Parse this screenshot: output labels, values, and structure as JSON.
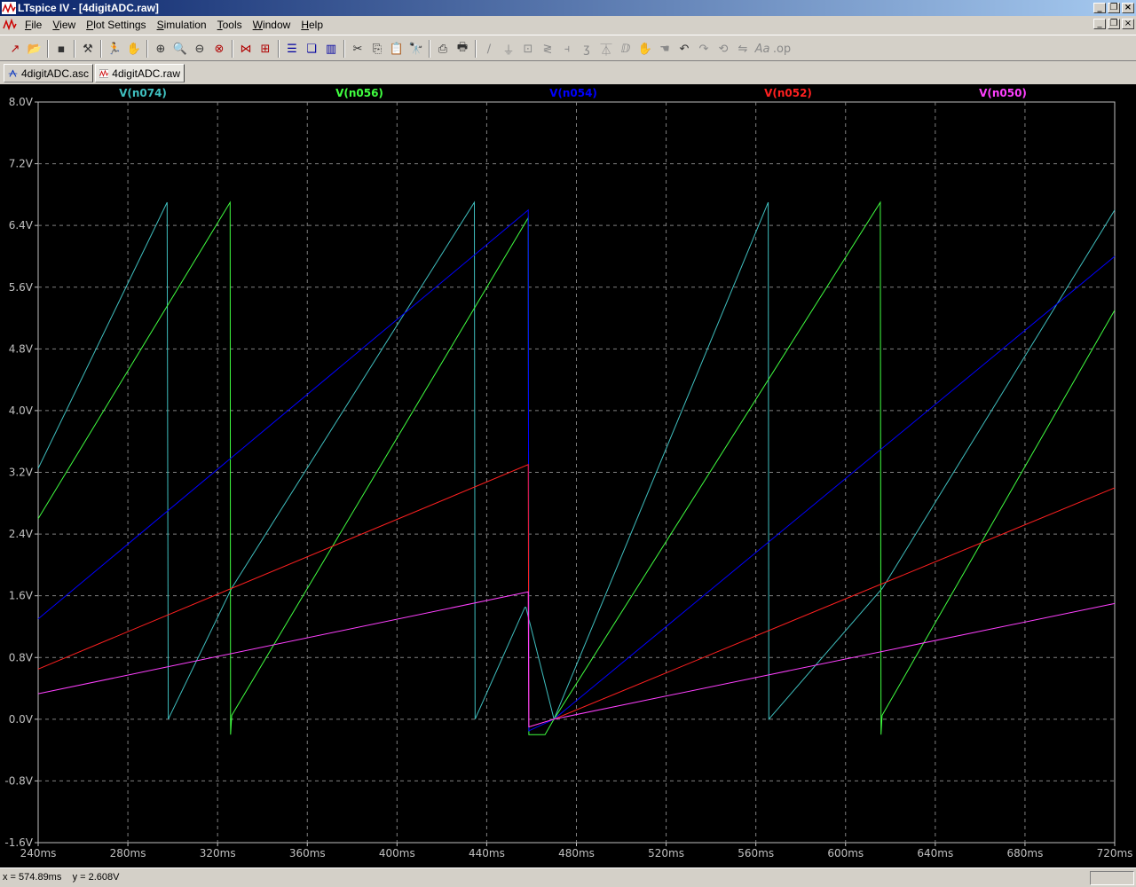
{
  "window": {
    "title": "LTspice IV - [4digitADC.raw]"
  },
  "menu": {
    "items": [
      "File",
      "View",
      "Plot Settings",
      "Simulation",
      "Tools",
      "Window",
      "Help"
    ]
  },
  "toolbar": {
    "icons": [
      "new-schematic-icon",
      "open-icon",
      "save-icon",
      "control-panel-icon",
      "run-icon",
      "halt-icon",
      "zoom-in-icon",
      "zoom-area-icon",
      "zoom-out-icon",
      "zoom-cancel-icon",
      "autorange-icon",
      "grid-icon",
      "tile-horizontal-icon",
      "cascade-icon",
      "tile-vertical-icon",
      "cut-icon",
      "copy-icon",
      "paste-icon",
      "find-icon",
      "print-preview-icon",
      "print-icon",
      "wire-icon",
      "ground-icon",
      "label-net-icon",
      "resistor-icon",
      "capacitor-icon",
      "inductor-icon",
      "diode-icon",
      "component-icon",
      "move-icon",
      "drag-icon",
      "undo-icon",
      "redo-icon",
      "rotate-icon",
      "mirror-icon",
      "text-icon",
      "spice-directive-icon"
    ]
  },
  "tabs": [
    {
      "label": "4digitADC.asc",
      "icon": "schematic-icon"
    },
    {
      "label": "4digitADC.raw",
      "icon": "waveform-icon"
    }
  ],
  "status": {
    "x_readout": "x = 574.89ms",
    "y_readout": "y = 2.608V"
  },
  "chart_data": {
    "type": "line",
    "xlabel": "",
    "ylabel": "",
    "xlim": [
      240,
      720
    ],
    "ylim": [
      -1.6,
      8.0
    ],
    "x_ticks": [
      "240ms",
      "280ms",
      "320ms",
      "360ms",
      "400ms",
      "440ms",
      "480ms",
      "520ms",
      "560ms",
      "600ms",
      "640ms",
      "680ms",
      "720ms"
    ],
    "y_ticks": [
      "8.0V",
      "7.2V",
      "6.4V",
      "5.6V",
      "4.8V",
      "4.0V",
      "3.2V",
      "2.4V",
      "1.6V",
      "0.8V",
      "0.0V",
      "-0.8V",
      "-1.6V"
    ],
    "grid": true,
    "series": [
      {
        "name": "V(n074)",
        "color": "#3fbfbf",
        "x": [
          240,
          297.5,
          298,
          326.3,
          326.3,
          434.5,
          434.8,
          457,
          457.5,
          470,
          565.5,
          565.8,
          616.5,
          616.5,
          720
        ],
        "y": [
          3.25,
          6.7,
          0.0,
          1.7,
          1.7,
          6.7,
          0.0,
          1.45,
          1.45,
          0.0,
          6.7,
          0.0,
          1.7,
          1.7,
          6.6
        ]
      },
      {
        "name": "V(n056)",
        "color": "#40ff40",
        "x": [
          240,
          325.6,
          325.8,
          326.3,
          458.5,
          458.8,
          464,
          466,
          470,
          615.5,
          615.8,
          616.3,
          720
        ],
        "y": [
          2.6,
          6.7,
          -0.2,
          0.05,
          6.5,
          -0.2,
          -0.2,
          -0.2,
          0.0,
          6.7,
          -0.2,
          0.05,
          5.3
        ]
      },
      {
        "name": "V(n054)",
        "color": "#0000ff",
        "x": [
          240,
          458.5,
          458.8,
          470,
          720
        ],
        "y": [
          1.3,
          6.6,
          -0.15,
          0.0,
          6.0
        ]
      },
      {
        "name": "V(n052)",
        "color": "#ff2020",
        "x": [
          240,
          458.5,
          458.8,
          470,
          720
        ],
        "y": [
          0.65,
          3.3,
          -0.1,
          0.0,
          3.0
        ]
      },
      {
        "name": "V(n050)",
        "color": "#ff40ff",
        "x": [
          240,
          458.5,
          458.8,
          470,
          720
        ],
        "y": [
          0.33,
          1.65,
          -0.1,
          0.0,
          1.5
        ]
      }
    ]
  }
}
